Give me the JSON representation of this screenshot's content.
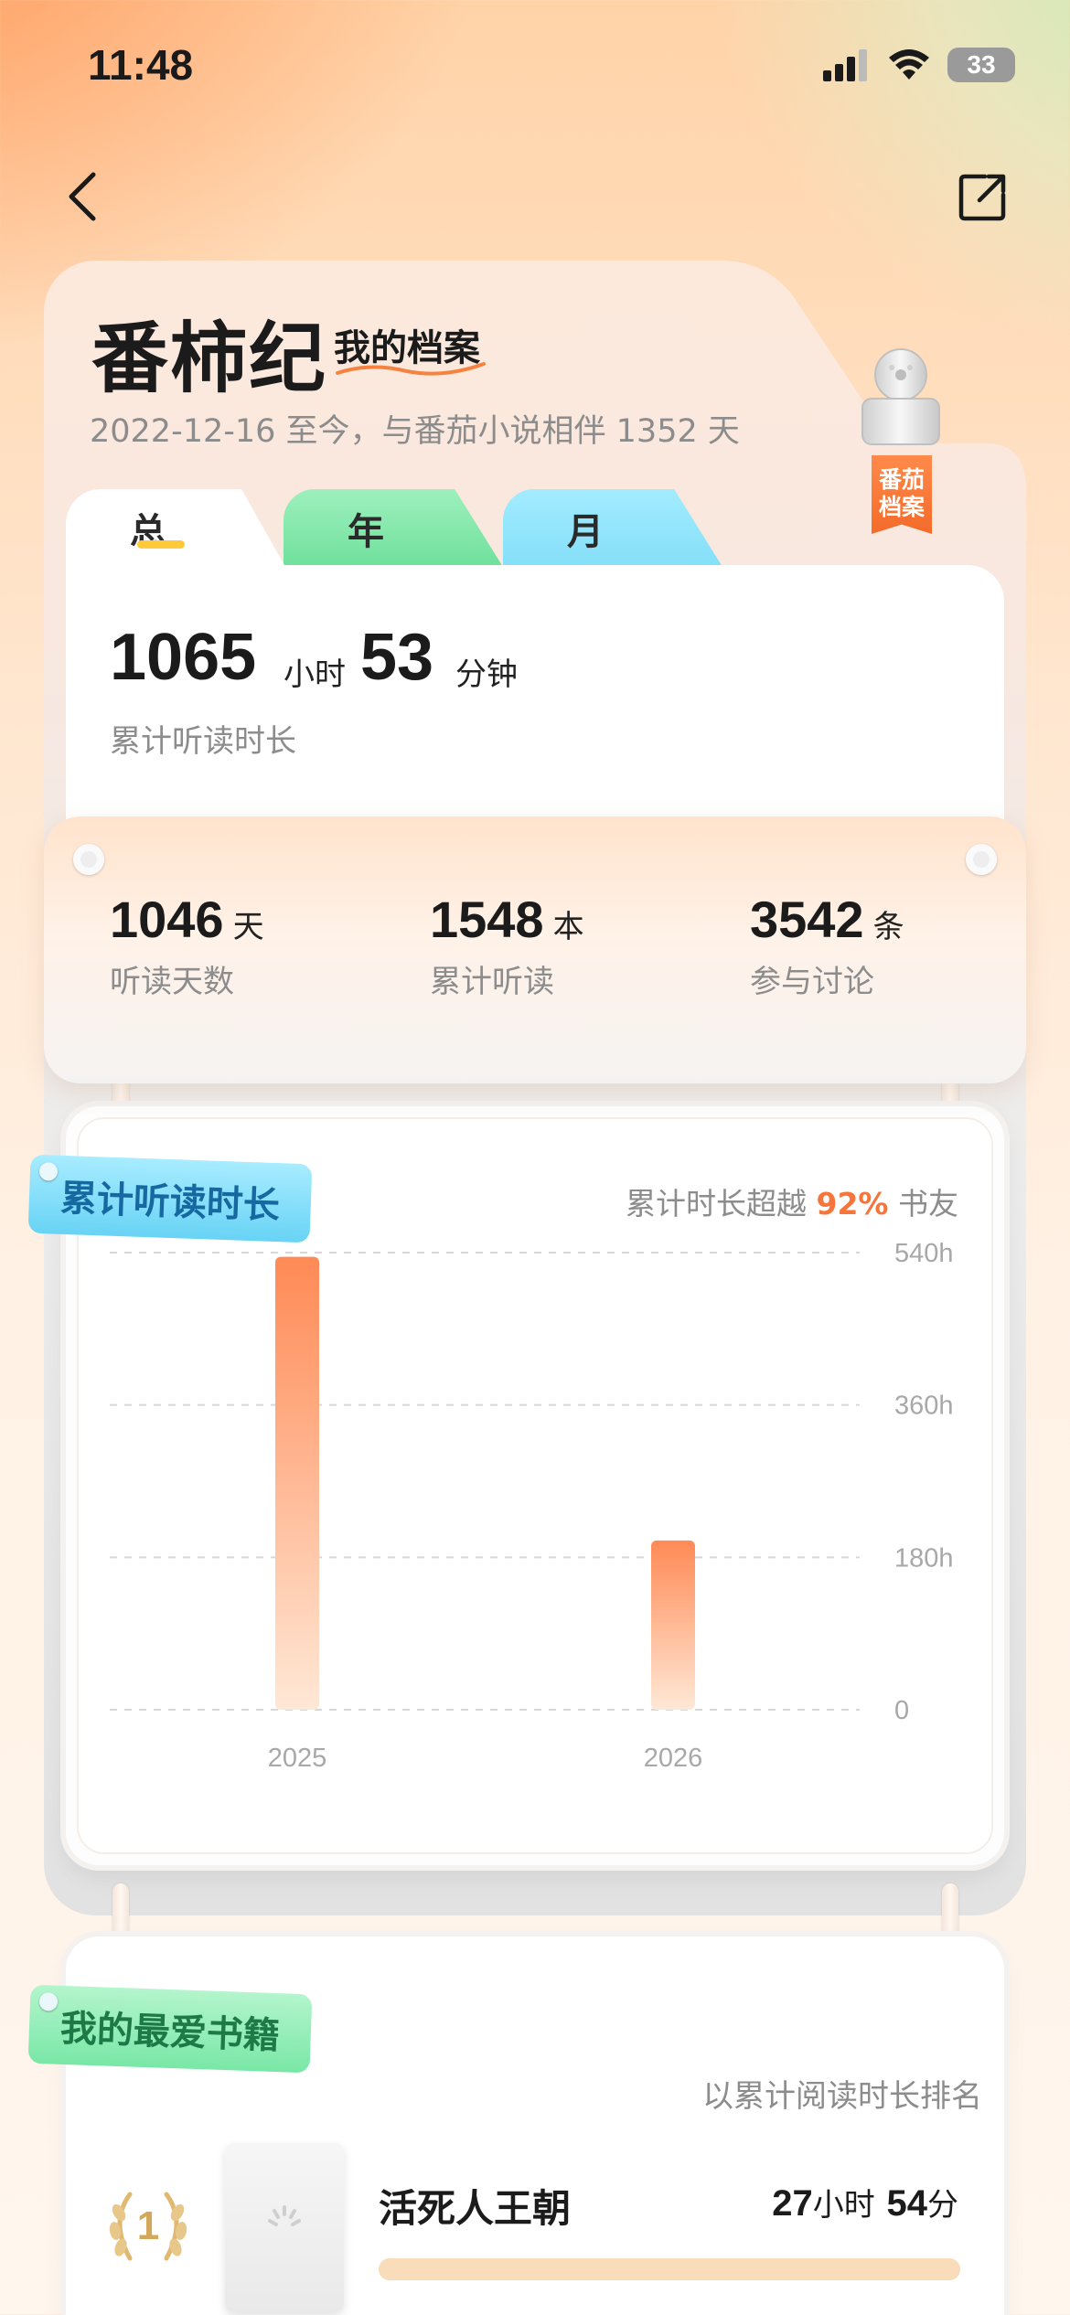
{
  "status_bar": {
    "time": "11:48",
    "battery": "33"
  },
  "nav": {
    "back_icon": "chevron-left-icon",
    "share_icon": "share-icon"
  },
  "header": {
    "title": "番柿纪",
    "subtitle": "我的档案",
    "since_text": "2022-12-16 至今，与番茄小说相伴 1352 天",
    "badge_text": "番茄\n档案"
  },
  "tabs": [
    {
      "label": "总",
      "active": true
    },
    {
      "label": "年",
      "active": false
    },
    {
      "label": "月",
      "active": false
    }
  ],
  "total": {
    "hours": "1065",
    "hours_unit": "小时",
    "minutes": "53",
    "minutes_unit": "分钟",
    "label": "累计听读时长"
  },
  "stats": [
    {
      "value": "1046",
      "unit": "天",
      "label": "听读天数"
    },
    {
      "value": "1548",
      "unit": "本",
      "label": "累计听读"
    },
    {
      "value": "3542",
      "unit": "条",
      "label": "参与讨论"
    }
  ],
  "chart_section": {
    "tag": "累计听读时长",
    "note_prefix": "累计时长超越",
    "note_percent": "92%",
    "note_suffix": "书友"
  },
  "chart_data": {
    "type": "bar",
    "categories": [
      "2025",
      "2026"
    ],
    "values": [
      535,
      200
    ],
    "ylim": [
      0,
      540
    ],
    "y_ticks": [
      0,
      180,
      360,
      540
    ],
    "y_tick_labels": [
      "0",
      "180h",
      "360h",
      "540h"
    ],
    "grid": true,
    "colors": {
      "bar_top": "#ff8a55",
      "bar_bottom": "#ffe8d6"
    }
  },
  "favorites_section": {
    "tag": "我的最爱书籍",
    "note": "以累计阅读时长排名",
    "books": [
      {
        "rank": "1",
        "title": "活死人王朝",
        "hours": "27",
        "hours_unit": "小时",
        "minutes": "54",
        "minutes_unit": "分",
        "progress": 1.0
      }
    ]
  },
  "colors": {
    "accent": "#f5753a",
    "tab_year": "#6fe09c",
    "tab_month": "#84dff8",
    "badge": "#f36b2a"
  }
}
